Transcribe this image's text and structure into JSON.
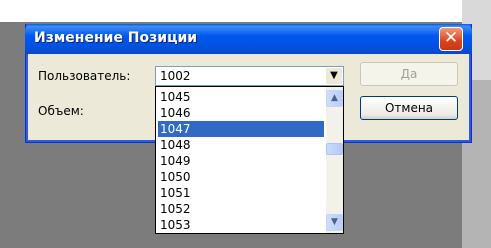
{
  "dialog": {
    "title": "Изменение Позиции",
    "close_glyph": "✕"
  },
  "form": {
    "user_label": "Пользователь:",
    "user_value": "1002",
    "volume_label": "Объем:"
  },
  "buttons": {
    "ok_label": "Да",
    "ok_enabled": false,
    "cancel_label": "Отмена"
  },
  "dropdown": {
    "items": [
      "1045",
      "1046",
      "1047",
      "1048",
      "1049",
      "1050",
      "1051",
      "1052",
      "1053"
    ],
    "selected_index": 2,
    "selected_value": "1047"
  },
  "icons": {
    "combo_arrow": "chevron-down-icon",
    "scroll_up": "scroll-up-icon",
    "scroll_down": "scroll-down-icon",
    "close": "close-icon"
  },
  "colors": {
    "titlebar": "#0058ee",
    "selection": "#316ac5",
    "close_button": "#d9441c",
    "dialog_bg": "#ece9d8"
  }
}
